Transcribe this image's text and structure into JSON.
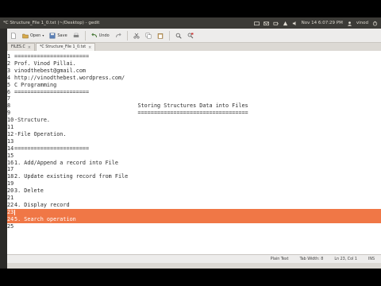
{
  "window": {
    "title": "*C Structure_File 1_0.txt (~/Desktop) - gedit",
    "clock": "Nov 14  6:07:29 PM",
    "user": "vinod"
  },
  "toolbar": {
    "open_label": "Open",
    "save_label": "Save",
    "undo_label": "Undo"
  },
  "tabs": [
    {
      "label": "FILES.C"
    },
    {
      "label": "*C Structure_File 1_0.txt"
    }
  ],
  "editor": {
    "lines": [
      {
        "n": "1",
        "t": "======================="
      },
      {
        "n": "2",
        "t": "Prof. Vinod Pillai."
      },
      {
        "n": "3",
        "t": "vinodthebest@gmail.com"
      },
      {
        "n": "4",
        "t": "http://vinodthebest.wordpress.com/"
      },
      {
        "n": "5",
        "t": "C Programming"
      },
      {
        "n": "6",
        "t": "======================="
      },
      {
        "n": "7",
        "t": ""
      },
      {
        "n": "8",
        "t": "                                      Storing Structures Data into Files"
      },
      {
        "n": "9",
        "t": "                                      =================================="
      },
      {
        "n": "10",
        "t": "-Structure."
      },
      {
        "n": "11",
        "t": ""
      },
      {
        "n": "12",
        "t": "-File Operation."
      },
      {
        "n": "13",
        "t": ""
      },
      {
        "n": "14",
        "t": "======================="
      },
      {
        "n": "15",
        "t": ""
      },
      {
        "n": "16",
        "t": "1. Add/Append a record into File"
      },
      {
        "n": "17",
        "t": ""
      },
      {
        "n": "18",
        "t": "2. Update existing record from File"
      },
      {
        "n": "19",
        "t": ""
      },
      {
        "n": "20",
        "t": "3. Delete"
      },
      {
        "n": "21",
        "t": ""
      },
      {
        "n": "22",
        "t": "4. Display record"
      },
      {
        "n": "23",
        "t": ""
      },
      {
        "n": "24",
        "t": "5. Search operation"
      },
      {
        "n": "25",
        "t": ""
      }
    ],
    "selected_lines": [
      23,
      24
    ]
  },
  "status": {
    "syntax": "Plain Text",
    "tab_width": "Tab Width:  8",
    "position": "Ln 23, Col 1",
    "mode": "INS"
  },
  "colors": {
    "selection": "#f07746",
    "panel": "#3c3b37"
  }
}
